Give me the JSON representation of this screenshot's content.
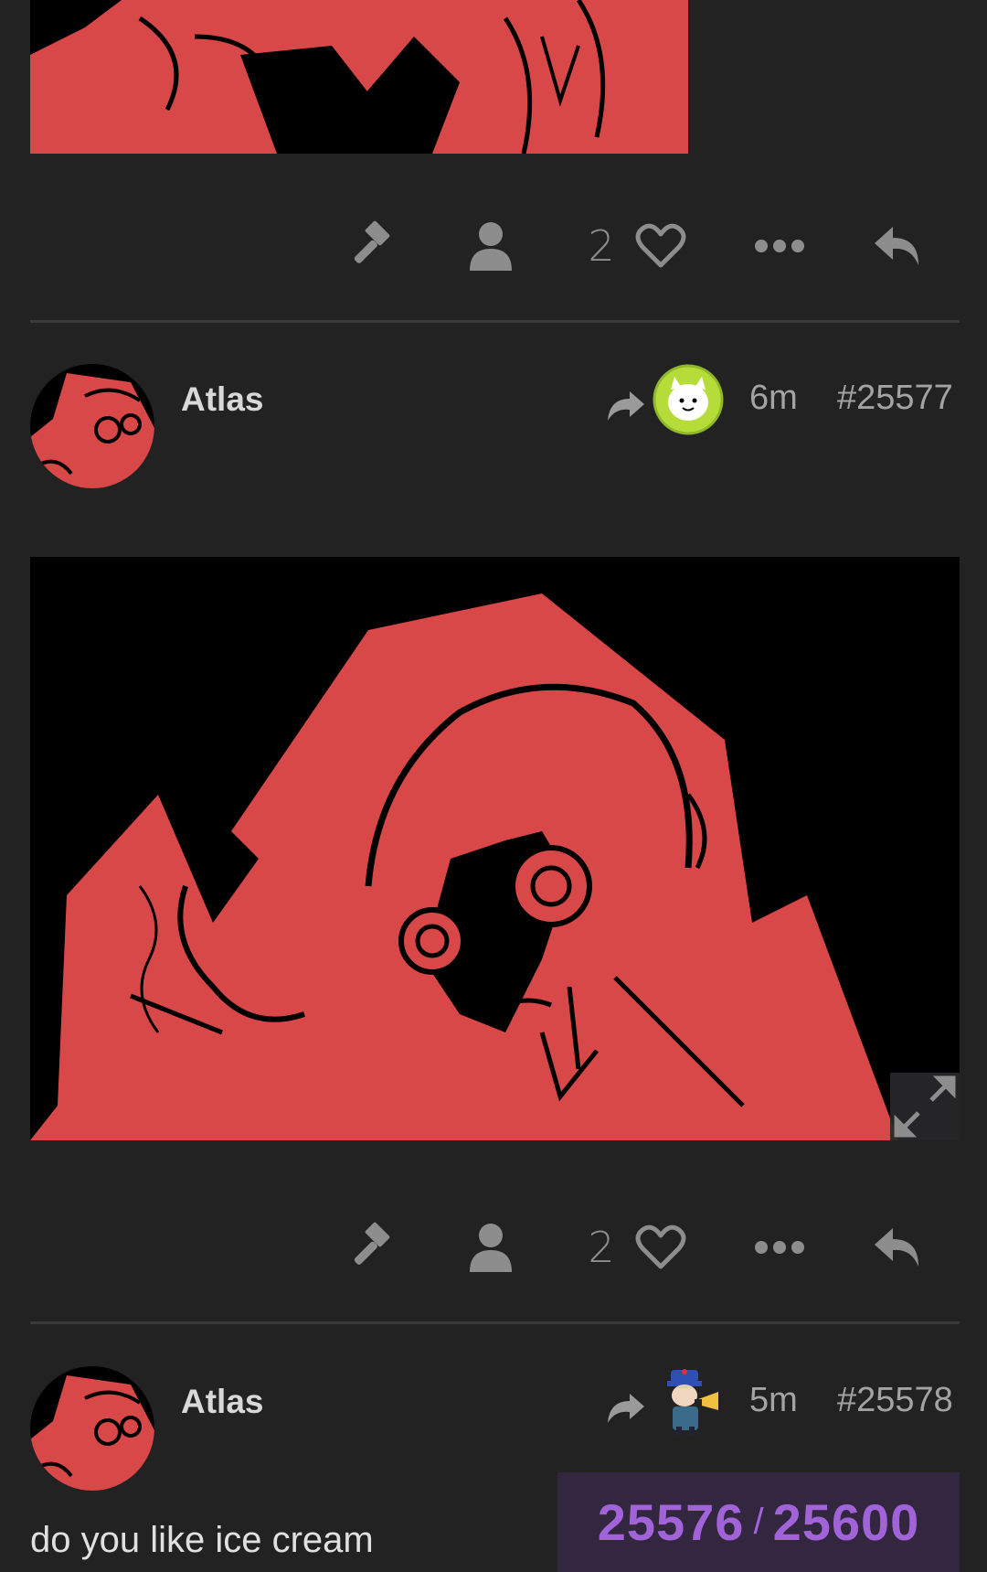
{
  "posts": [
    {
      "author": "",
      "like_count": "2",
      "has_image": true,
      "image_description": ""
    },
    {
      "author": "Atlas",
      "reply_to_avatar": "cat-avatar-icon",
      "time": "6m",
      "number": "#25577",
      "like_count": "2",
      "has_image": true
    },
    {
      "author": "Atlas",
      "reply_to_avatar": "character-avatar-icon",
      "time": "5m",
      "number": "#25578",
      "text": "do you like ice cream"
    }
  ],
  "progress": {
    "current": "25576",
    "separator": "/",
    "total": "25600"
  },
  "colors": {
    "background": "#222223",
    "art_red": "#d94848",
    "accent_purple": "#a163d8",
    "progress_bg": "#33263f"
  },
  "icons": {
    "moderate": "gavel-icon",
    "profile": "user-icon",
    "like": "heart-icon",
    "more": "ellipsis-icon",
    "reply": "reply-icon",
    "reply_to": "reply-arrow-icon",
    "expand": "expand-icon"
  }
}
